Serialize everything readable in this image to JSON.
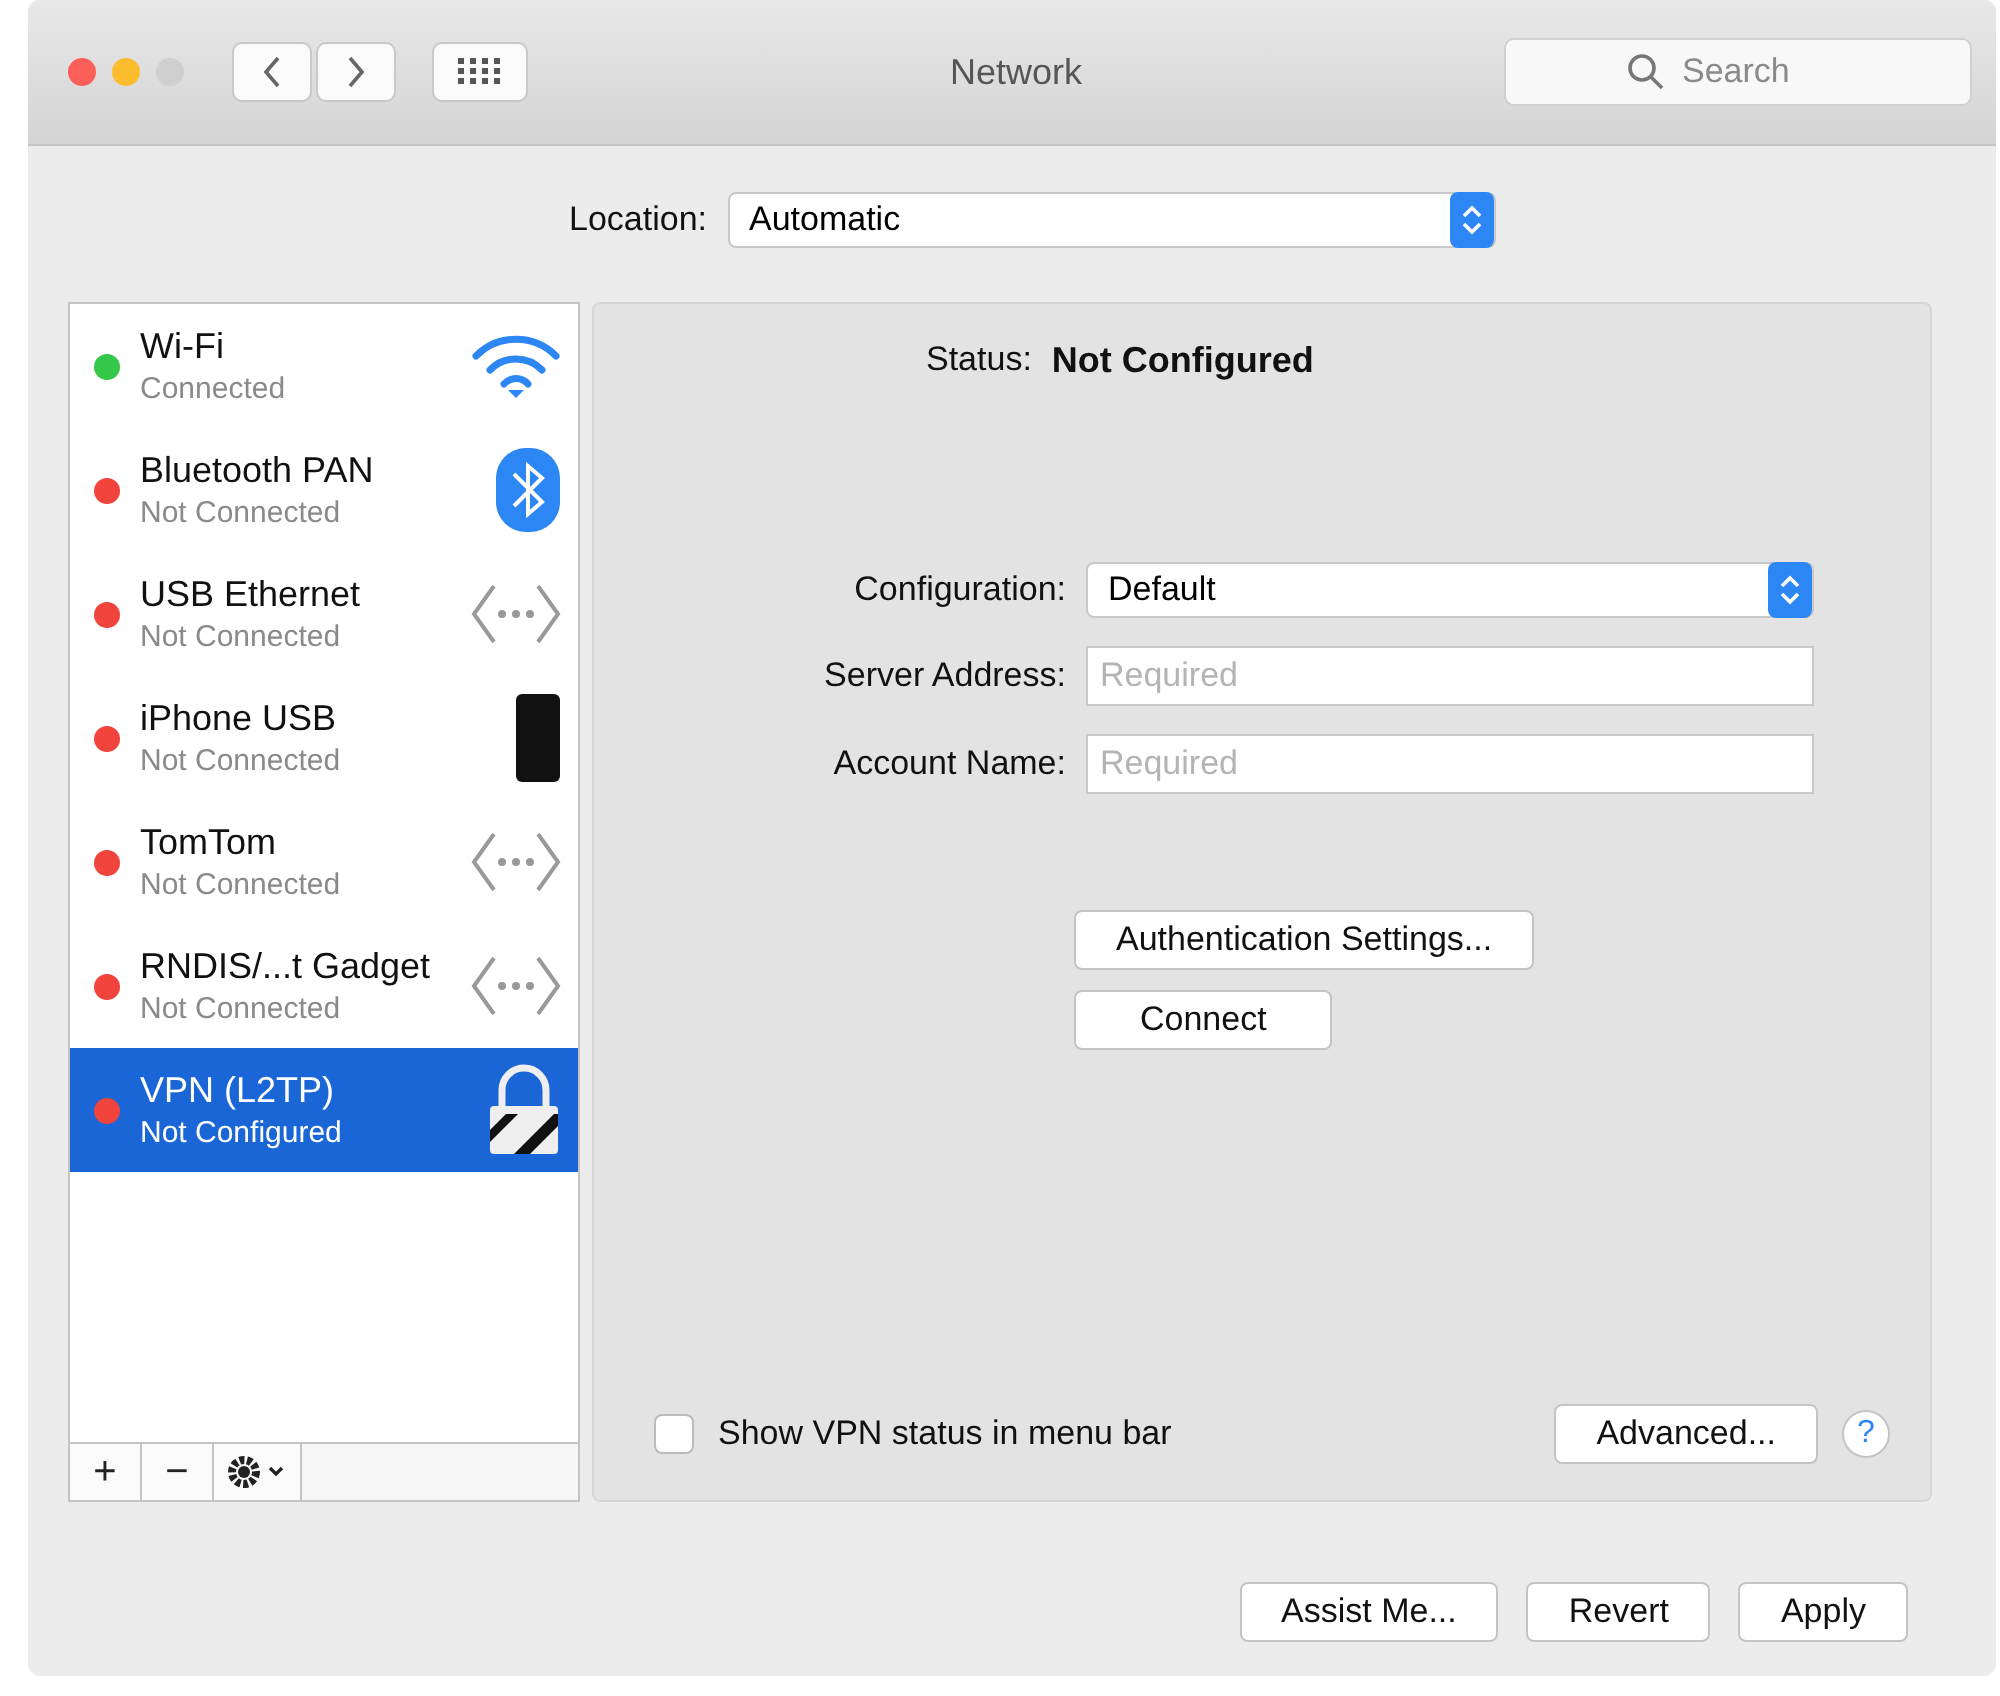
{
  "window": {
    "title": "Network"
  },
  "search": {
    "placeholder": "Search"
  },
  "location": {
    "label": "Location:",
    "value": "Automatic"
  },
  "services": [
    {
      "name": "Wi-Fi",
      "status": "Connected",
      "color": "#34c748",
      "kind": "wifi",
      "selected": false
    },
    {
      "name": "Bluetooth PAN",
      "status": "Not Connected",
      "color": "#f0443c",
      "kind": "bluetooth",
      "selected": false
    },
    {
      "name": "USB Ethernet",
      "status": "Not Connected",
      "color": "#f0443c",
      "kind": "ethernet",
      "selected": false
    },
    {
      "name": "iPhone USB",
      "status": "Not Connected",
      "color": "#f0443c",
      "kind": "phone",
      "selected": false
    },
    {
      "name": "TomTom",
      "status": "Not Connected",
      "color": "#f0443c",
      "kind": "ethernet",
      "selected": false
    },
    {
      "name": "RNDIS/...t Gadget",
      "status": "Not Connected",
      "color": "#f0443c",
      "kind": "ethernet",
      "selected": false
    },
    {
      "name": "VPN (L2TP)",
      "status": "Not Configured",
      "color": "#f0443c",
      "kind": "lock",
      "selected": true
    }
  ],
  "list_buttons": {
    "add": "+",
    "remove": "−"
  },
  "status": {
    "label": "Status:",
    "value": "Not Configured"
  },
  "fields": [
    {
      "kind": "select",
      "label": "Configuration:",
      "value": "Default"
    },
    {
      "kind": "text",
      "label": "Server Address:",
      "placeholder": "Required"
    },
    {
      "kind": "text",
      "label": "Account Name:",
      "placeholder": "Required"
    }
  ],
  "panel_buttons": [
    "Authentication Settings...",
    "Connect"
  ],
  "show_status": {
    "label": "Show VPN status in menu bar",
    "checked": false
  },
  "advanced": "Advanced...",
  "help": "?",
  "footer_buttons": [
    "Assist Me...",
    "Revert",
    "Apply"
  ]
}
